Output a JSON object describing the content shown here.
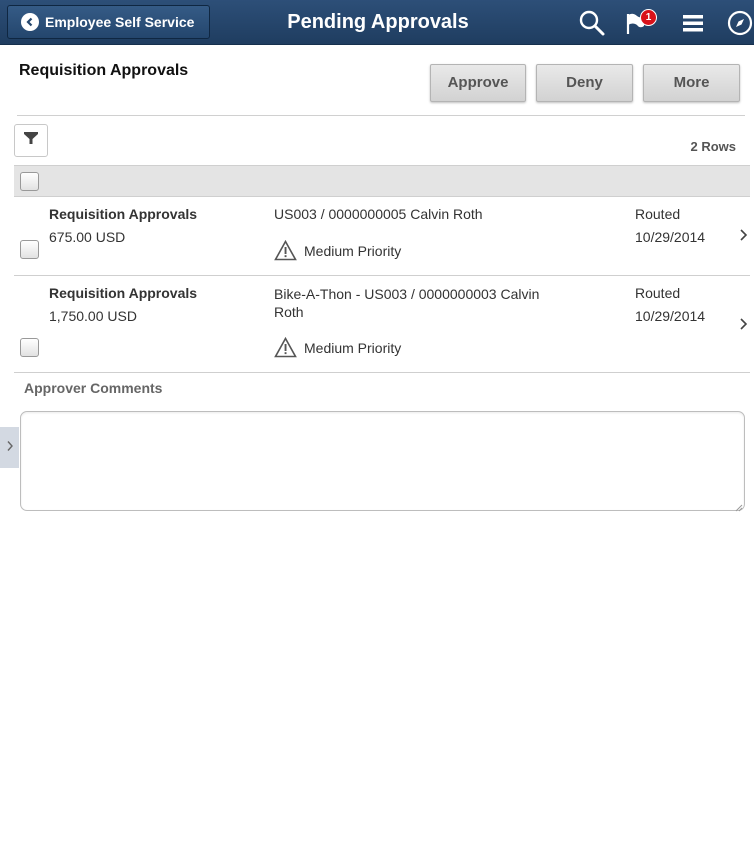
{
  "header": {
    "back_label": "Employee Self Service",
    "title": "Pending Approvals",
    "notification_count": "1",
    "icons": [
      "search-icon",
      "flag-icon",
      "menu-icon",
      "compass-icon"
    ]
  },
  "toolbar": {
    "section_title": "Requisition Approvals",
    "approve_label": "Approve",
    "deny_label": "Deny",
    "more_label": "More"
  },
  "grid": {
    "rows_count": "2 Rows",
    "rows": [
      {
        "title": "Requisition Approvals",
        "amount": "675.00 USD",
        "description": "US003 / 0000000005 Calvin Roth",
        "priority": "Medium Priority",
        "status": "Routed",
        "date": "10/29/2014"
      },
      {
        "title": "Requisition Approvals",
        "amount": "1,750.00 USD",
        "description": "Bike-A-Thon - US003 / 0000000003 Calvin Roth",
        "priority": "Medium Priority",
        "status": "Routed",
        "date": "10/29/2014"
      }
    ]
  },
  "comments": {
    "label": "Approver Comments",
    "value": ""
  },
  "colors": {
    "header_bg": "#24466d",
    "badge": "#d9121a"
  }
}
